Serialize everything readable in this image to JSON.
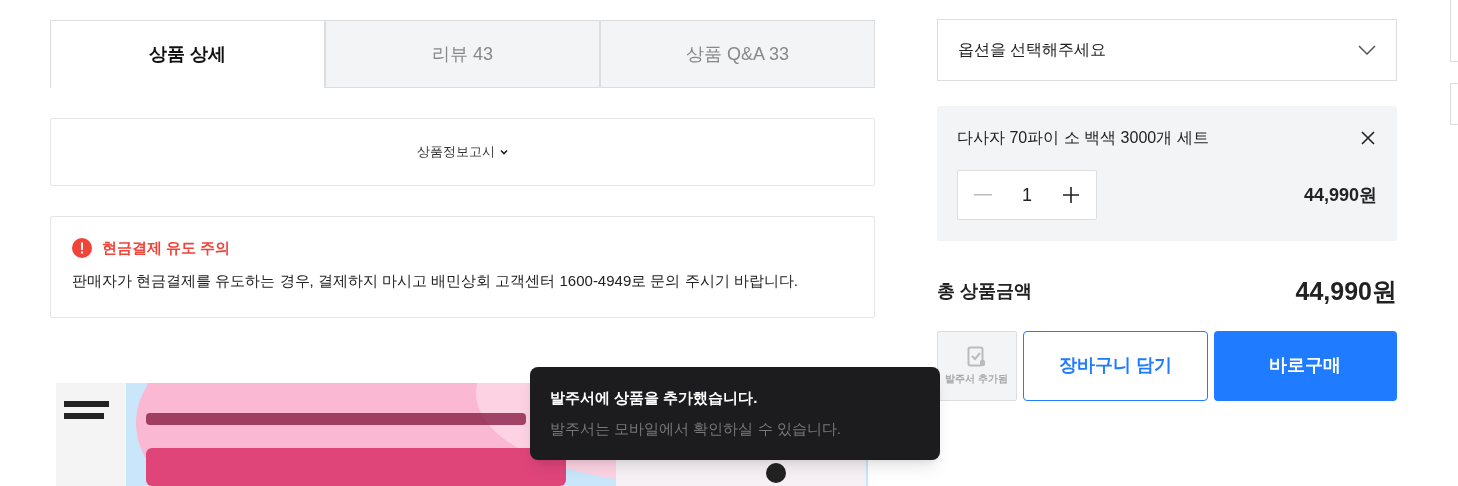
{
  "tabs": [
    {
      "label": "상품 상세",
      "selected": true
    },
    {
      "label": "리뷰 43",
      "selected": false
    },
    {
      "label": "상품 Q&A 33",
      "selected": false
    }
  ],
  "notice_toggle": {
    "label": "상품정보고시",
    "expanded": false
  },
  "warning": {
    "title": "현금결제 유도 주의",
    "text": "판매자가 현금결제를 유도하는 경우, 결제하지 마시고 배민상회 고객센터 1600-4949로 문의 주시기 바랍니다."
  },
  "toast": {
    "title": "발주서에 상품을 추가했습니다.",
    "message": "발주서는 모바일에서 확인하실 수 있습니다."
  },
  "option_select": {
    "placeholder": "옵션을 선택해주세요"
  },
  "selected_option": {
    "name": "다사자 70파이 소 백색 3000개 세트",
    "quantity": "1",
    "price": "44,990원"
  },
  "total": {
    "label": "총 상품금액",
    "amount": "44,990원"
  },
  "buttons": {
    "order_sheet": {
      "label": "발주서 추가됨",
      "disabled": true
    },
    "cart": "장바구니 담기",
    "buy": "바로구매"
  }
}
